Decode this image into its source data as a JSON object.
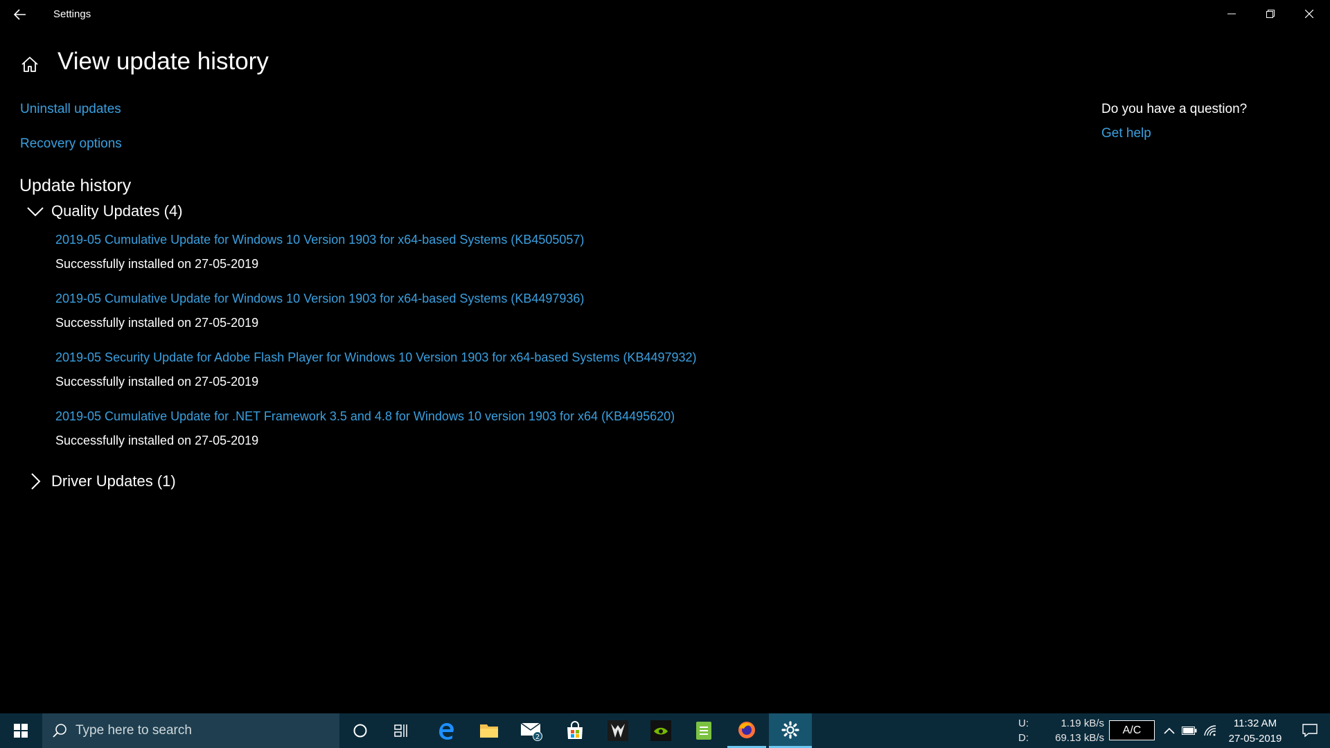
{
  "window": {
    "title": "Settings"
  },
  "page": {
    "title": "View update history"
  },
  "links": {
    "uninstall": "Uninstall updates",
    "recovery": "Recovery options"
  },
  "help": {
    "question": "Do you have a question?",
    "link": "Get help"
  },
  "history": {
    "title": "Update history",
    "quality_label": "Quality Updates (4)",
    "driver_label": "Driver Updates (1)",
    "items": [
      {
        "title": "2019-05 Cumulative Update for Windows 10 Version 1903 for x64-based Systems (KB4505057)",
        "status": "Successfully installed on 27-05-2019"
      },
      {
        "title": "2019-05 Cumulative Update for Windows 10 Version 1903 for x64-based Systems (KB4497936)",
        "status": "Successfully installed on 27-05-2019"
      },
      {
        "title": "2019-05 Security Update for Adobe Flash Player for Windows 10 Version 1903 for x64-based Systems (KB4497932)",
        "status": "Successfully installed on 27-05-2019"
      },
      {
        "title": "2019-05 Cumulative Update for .NET Framework 3.5 and 4.8 for Windows 10 version 1903 for x64 (KB4495620)",
        "status": "Successfully installed on 27-05-2019"
      }
    ]
  },
  "taskbar": {
    "search_placeholder": "Type here to search",
    "mail_badge": "2",
    "net_up_label": "U:",
    "net_down_label": "D:",
    "net_up": "1.19 kB/s",
    "net_down": "69.13 kB/s",
    "ac_label": "A/C",
    "time": "11:32 AM",
    "date": "27-05-2019",
    "icons": [
      "cortana-icon",
      "task-view-icon",
      "edge-icon",
      "file-explorer-icon",
      "mail-icon",
      "store-icon",
      "predator-icon",
      "nvidia-icon",
      "notes-icon",
      "firefox-icon",
      "settings-icon"
    ]
  },
  "colors": {
    "link": "#3aa0e0",
    "taskbar": "#0a2a3a",
    "accent": "#6cc6f0"
  }
}
